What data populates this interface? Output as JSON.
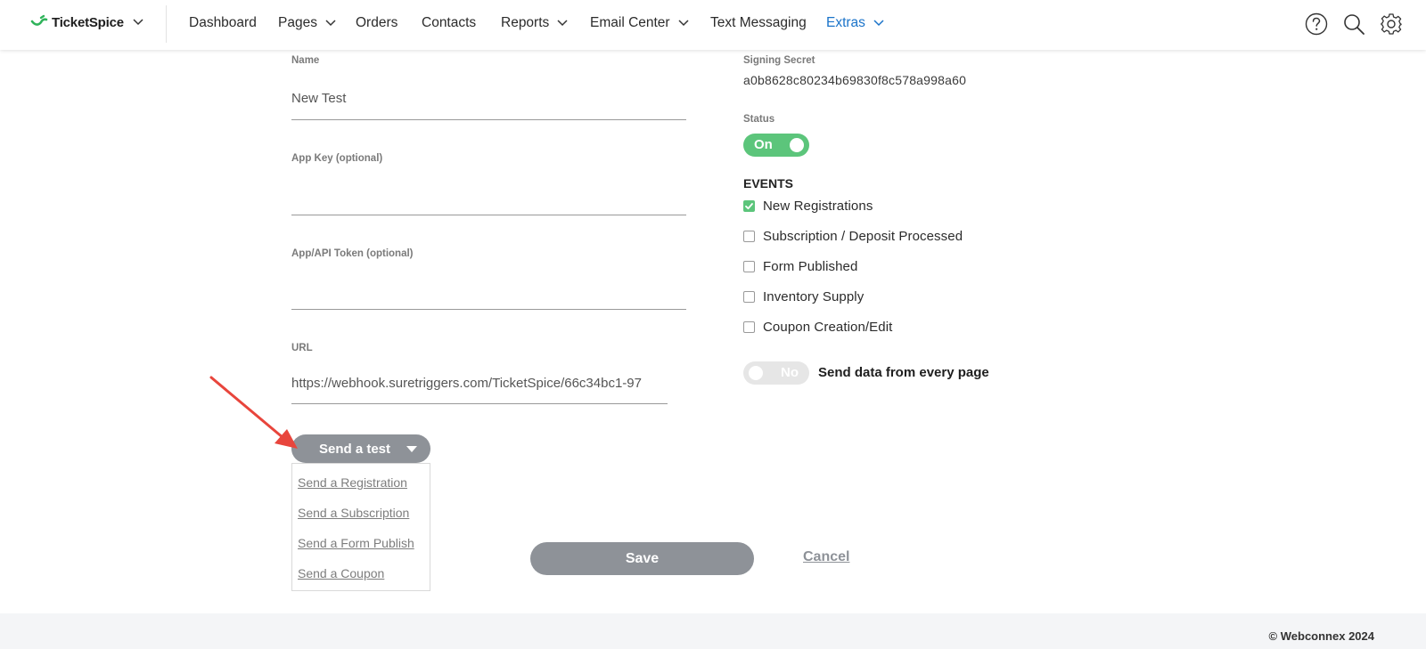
{
  "nav": {
    "brand": "TicketSpice",
    "items": [
      {
        "label": "Dashboard",
        "dropdown": false,
        "active": false
      },
      {
        "label": "Pages",
        "dropdown": true,
        "active": false
      },
      {
        "label": "Orders",
        "dropdown": false,
        "active": false
      },
      {
        "label": "Contacts",
        "dropdown": false,
        "active": false
      },
      {
        "label": "Reports",
        "dropdown": true,
        "active": false
      },
      {
        "label": "Email Center",
        "dropdown": true,
        "active": false
      },
      {
        "label": "Text Messaging",
        "dropdown": false,
        "active": false
      },
      {
        "label": "Extras",
        "dropdown": true,
        "active": true
      }
    ],
    "icons": [
      "help-icon",
      "search-icon",
      "gear-icon"
    ]
  },
  "form": {
    "name_label": "Name",
    "name_value": "New Test",
    "app_key_label": "App Key (optional)",
    "app_key_value": "",
    "api_token_label": "App/API Token (optional)",
    "api_token_value": "",
    "url_label": "URL",
    "url_value": "https://webhook.suretriggers.com/TicketSpice/66c34bc1-97"
  },
  "settings": {
    "signing_secret_label": "Signing Secret",
    "signing_secret_value": "a0b8628c80234b69830f8c578a998a60",
    "status_label": "Status",
    "status_toggle": "On",
    "events_title": "EVENTS",
    "events": [
      {
        "label": "New Registrations",
        "checked": true
      },
      {
        "label": "Subscription / Deposit Processed",
        "checked": false
      },
      {
        "label": "Form Published",
        "checked": false
      },
      {
        "label": "Inventory Supply",
        "checked": false
      },
      {
        "label": "Coupon Creation/Edit",
        "checked": false
      }
    ],
    "every_page_toggle": "No",
    "every_page_label": "Send data from every page"
  },
  "test": {
    "button_label": "Send a test",
    "options": [
      "Send a Registration",
      "Send a Subscription",
      "Send a Form Publish",
      "Send a Coupon"
    ]
  },
  "actions": {
    "save_label": "Save",
    "cancel_label": "Cancel"
  },
  "footer": {
    "copyright": "© Webconnex 2024"
  },
  "colors": {
    "accent": "#1a73c9",
    "toggle_on": "#5cc57b",
    "button_gray": "#8e9298",
    "annotation_arrow": "#e8453c"
  }
}
